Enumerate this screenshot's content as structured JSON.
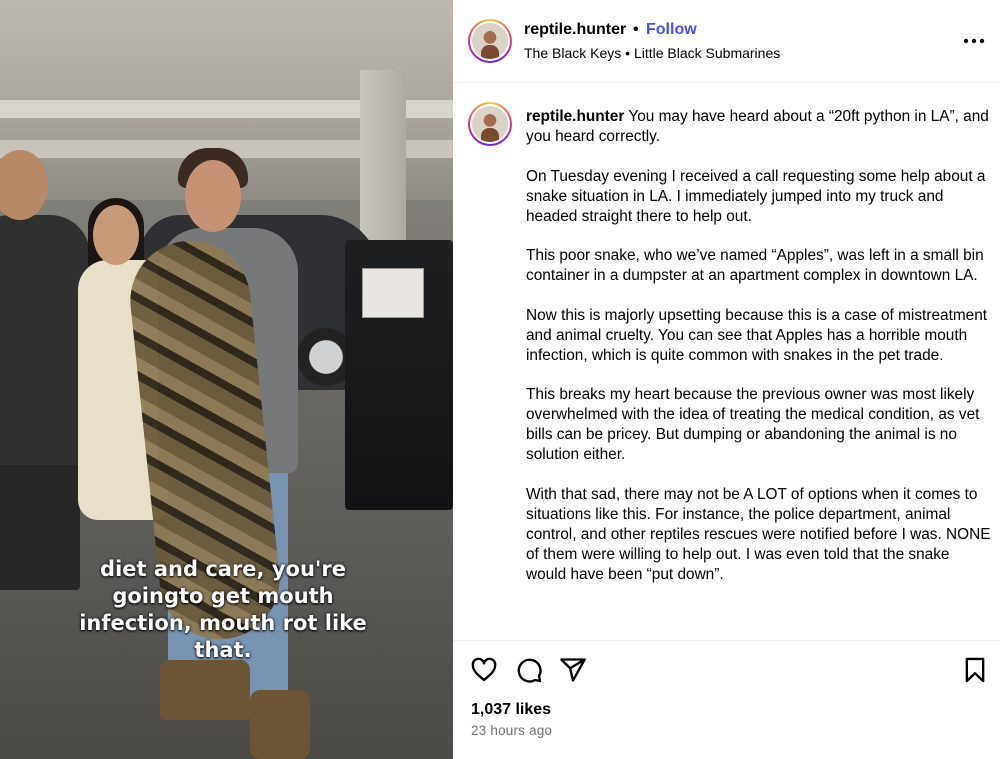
{
  "media": {
    "caption": "diet and care, you're goingto get mouth infection, mouth rot like that."
  },
  "header": {
    "username": "reptile.hunter",
    "separator": "•",
    "follow_label": "Follow",
    "audio": "The Black Keys • Little Black Submarines",
    "more_icon": "more-horizontal-icon"
  },
  "post": {
    "username": "reptile.hunter",
    "paragraphs": [
      "You may have heard about a “20ft python in LA”, and you heard correctly.",
      "On Tuesday evening I received a call requesting some help about a snake situation in LA. I immediately jumped into my truck and headed straight there to help out.",
      "This poor snake, who we’ve named “Apples”, was left in a small bin container in a dumpster at an apartment complex in downtown LA.",
      "Now this is majorly upsetting because this is a case of mistreatment and animal cruelty. You can see that Apples has a horrible mouth infection, which is quite common with snakes in the pet trade.",
      "This breaks my heart because the previous owner was most likely overwhelmed with the idea of treating the medical condition, as vet bills can be pricey. But dumping or abandoning the animal is no solution either.",
      "With that sad, there may not be A LOT of options when it comes to situations like this. For instance, the police department, animal control, and other reptiles rescues were notified before I was. NONE of them were willing to help out. I was even told that the snake would have been “put down”."
    ]
  },
  "actions": {
    "icons": [
      "heart-icon",
      "comment-icon",
      "share-icon",
      "bookmark-icon"
    ],
    "likes": "1,037 likes",
    "time": "23 hours ago"
  }
}
